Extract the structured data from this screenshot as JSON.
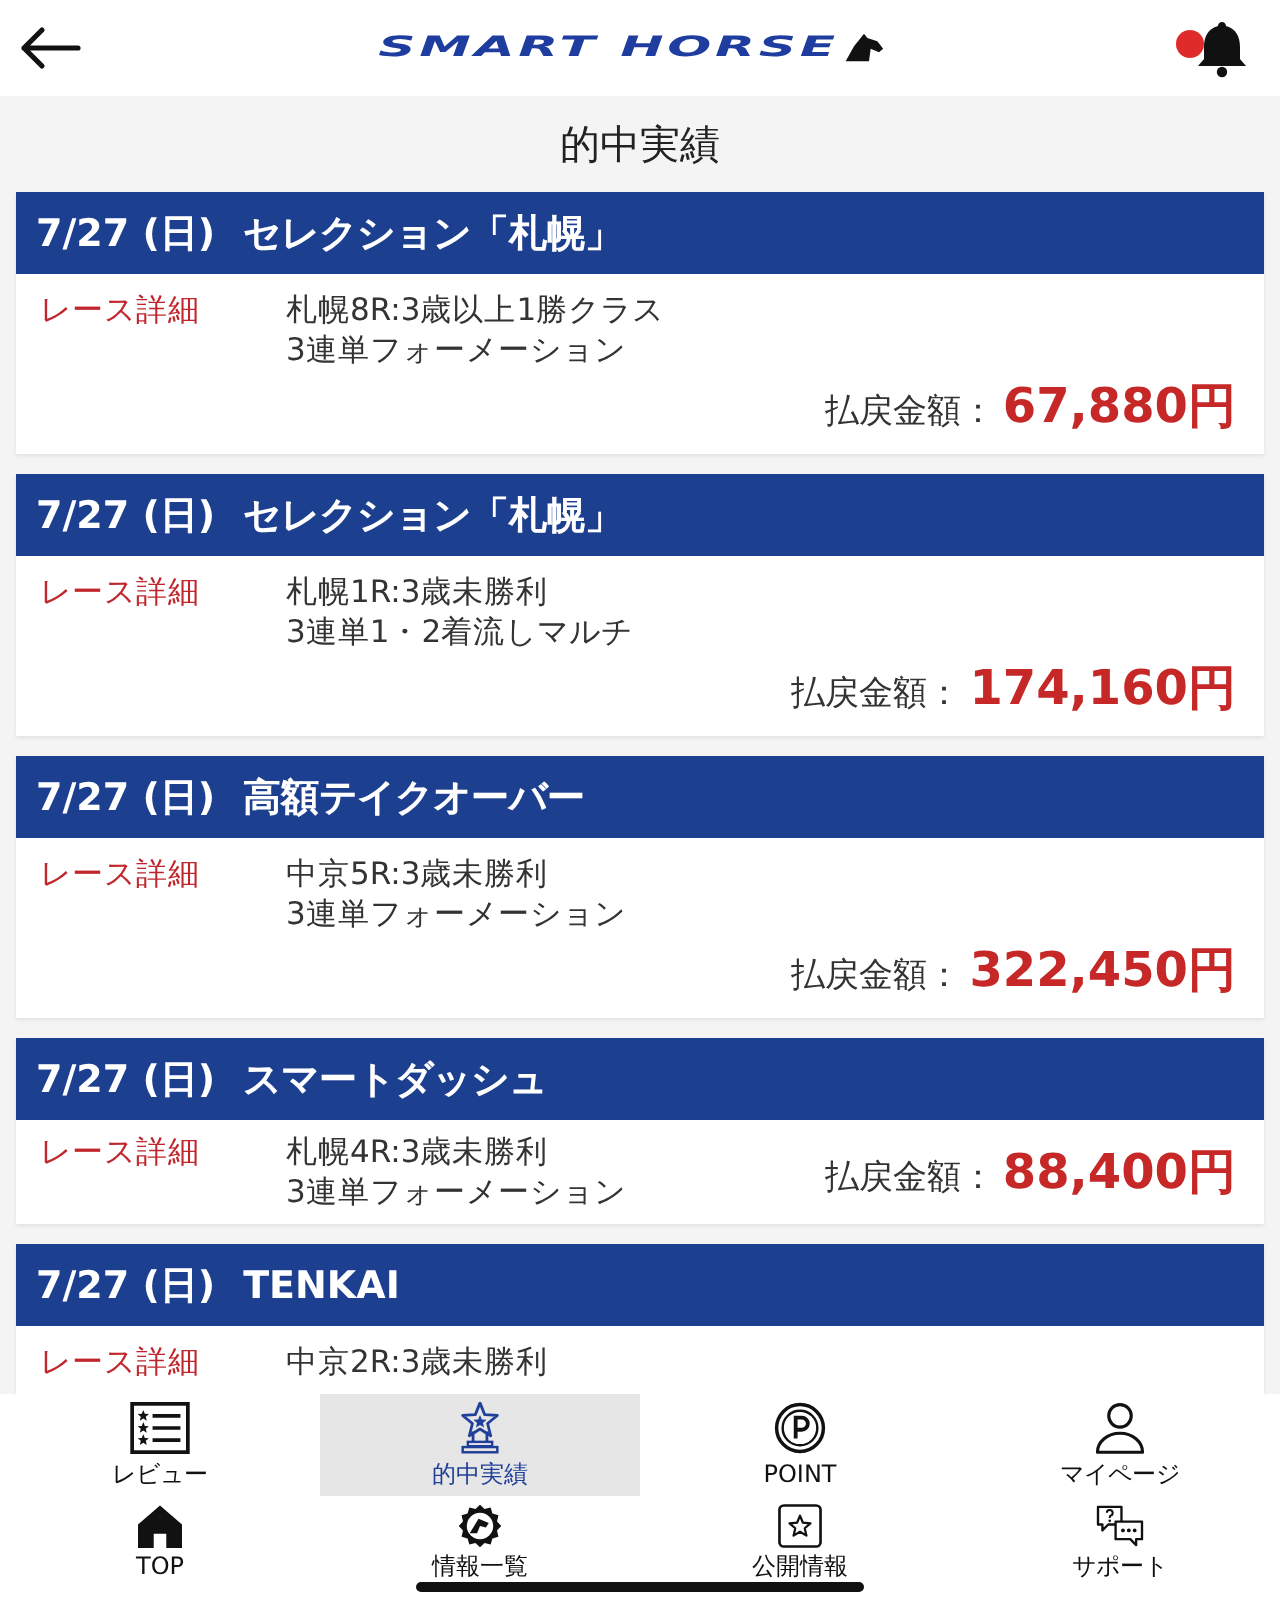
{
  "header": {
    "logo": "SMART HORSE",
    "unread": true
  },
  "page_title": "的中実績",
  "results": [
    {
      "date": "7/27 (日)",
      "title": "セレクション「札幌」",
      "link": "レース詳細",
      "race": "札幌8R:3歳以上1勝クラス",
      "bet_type": "3連単フォーメーション",
      "payout_label": "払戻金額：",
      "payout": "67,880円",
      "kind": "stacked"
    },
    {
      "date": "7/27 (日)",
      "title": "セレクション「札幌」",
      "link": "レース詳細",
      "race": "札幌1R:3歳未勝利",
      "bet_type": "3連単1・2着流しマルチ",
      "payout_label": "払戻金額：",
      "payout": "174,160円",
      "kind": "stacked"
    },
    {
      "date": "7/27 (日)",
      "title": "高額テイクオーバー",
      "link": "レース詳細",
      "race": "中京5R:3歳未勝利",
      "bet_type": "3連単フォーメーション",
      "payout_label": "払戻金額：",
      "payout": "322,450円",
      "kind": "stacked"
    },
    {
      "date": "7/27 (日)",
      "title": "スマートダッシュ",
      "link": "レース詳細",
      "race": "札幌4R:3歳未勝利",
      "bet_type": "3連単フォーメーション",
      "payout_label": "払戻金額：",
      "payout": "88,400円",
      "kind": "inline"
    },
    {
      "date": "7/27 (日)",
      "title": "TENKAI",
      "link": "レース詳細",
      "race": "中京2R:3歳未勝利",
      "kind": "stacked"
    }
  ],
  "nav": [
    {
      "label": "レビュー",
      "selected": false
    },
    {
      "label": "的中実績",
      "selected": true
    },
    {
      "label": "POINT",
      "selected": false
    },
    {
      "label": "マイページ",
      "selected": false
    },
    {
      "label": "TOP",
      "selected": false
    },
    {
      "label": "情報一覧",
      "selected": false
    },
    {
      "label": "公開情報",
      "selected": false
    },
    {
      "label": "サポート",
      "selected": false
    }
  ]
}
